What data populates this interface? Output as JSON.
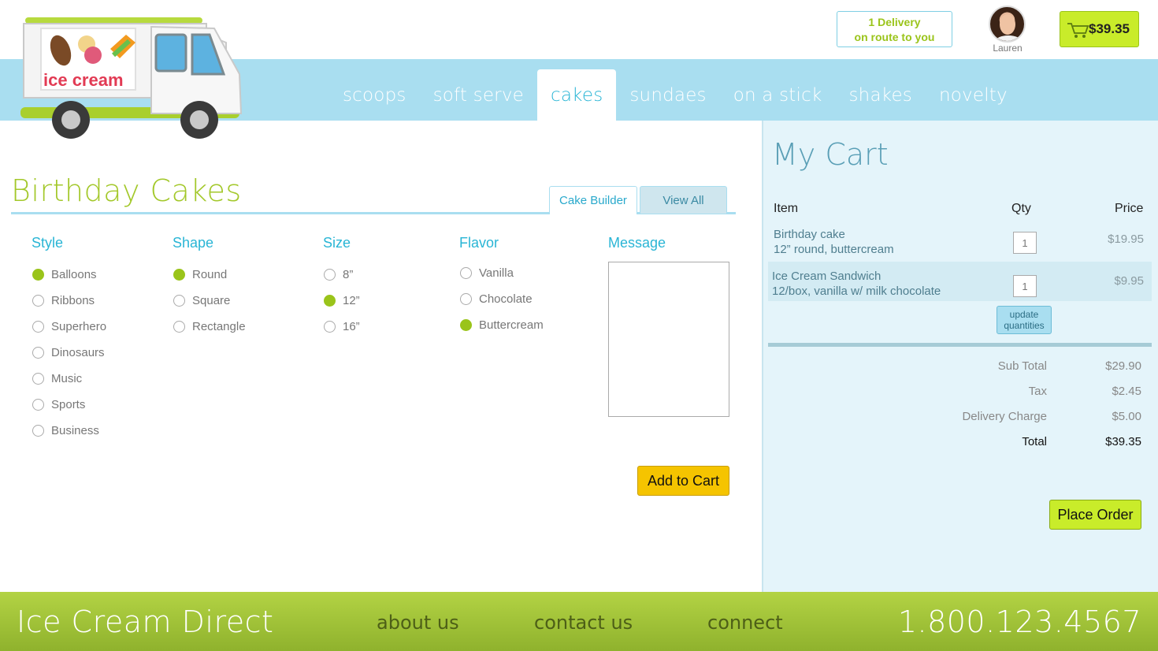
{
  "header": {
    "delivery_line1": "1 Delivery",
    "delivery_line2": "on route to you",
    "user_name": "Lauren",
    "cart_total": "$39.35",
    "logo_text": "ice cream"
  },
  "nav": {
    "items": [
      {
        "label": "scoops"
      },
      {
        "label": "soft serve"
      },
      {
        "label": "cakes",
        "active": true
      },
      {
        "label": "sundaes"
      },
      {
        "label": "on a stick"
      },
      {
        "label": "shakes"
      },
      {
        "label": "novelty"
      }
    ]
  },
  "main": {
    "title": "Birthday Cakes",
    "tabs": [
      {
        "label": "Cake Builder",
        "active": true
      },
      {
        "label": "View All"
      }
    ],
    "style": {
      "label": "Style",
      "options": [
        "Balloons",
        "Ribbons",
        "Superhero",
        "Dinosaurs",
        "Music",
        "Sports",
        "Business"
      ],
      "selected": "Balloons"
    },
    "shape": {
      "label": "Shape",
      "options": [
        "Round",
        "Square",
        "Rectangle"
      ],
      "selected": "Round"
    },
    "size": {
      "label": "Size",
      "options": [
        "8”",
        "12”",
        "16”"
      ],
      "selected": "12”"
    },
    "flavor": {
      "label": "Flavor",
      "options": [
        "Vanilla",
        "Chocolate",
        "Buttercream"
      ],
      "selected": "Buttercream"
    },
    "message": {
      "label": "Message",
      "value": ""
    },
    "add_to_cart_label": "Add to Cart"
  },
  "cart": {
    "title": "My Cart",
    "col_item": "Item",
    "col_qty": "Qty",
    "col_price": "Price",
    "items": [
      {
        "name": "Birthday cake",
        "detail": "12” round, buttercream",
        "qty": "1",
        "price": "$19.95"
      },
      {
        "name": "Ice Cream Sandwich",
        "detail": "12/box, vanilla w/ milk chocolate",
        "qty": "1",
        "price": "$9.95"
      }
    ],
    "update_label_1": "update",
    "update_label_2": "quantities",
    "subtotal_label": "Sub Total",
    "subtotal": "$29.90",
    "tax_label": "Tax",
    "tax": "$2.45",
    "delivery_label": "Delivery Charge",
    "delivery": "$5.00",
    "total_label": "Total",
    "total": "$39.35",
    "place_order_label": "Place Order"
  },
  "footer": {
    "brand": "Ice Cream Direct",
    "links": [
      "about us",
      "contact us",
      "connect"
    ],
    "phone": "1.800.123.4567"
  },
  "colors": {
    "nav_band": "#a9def0",
    "accent_green": "#9ac41a",
    "accent_blue": "#29b5d5",
    "button_yellow": "#f5c400"
  }
}
